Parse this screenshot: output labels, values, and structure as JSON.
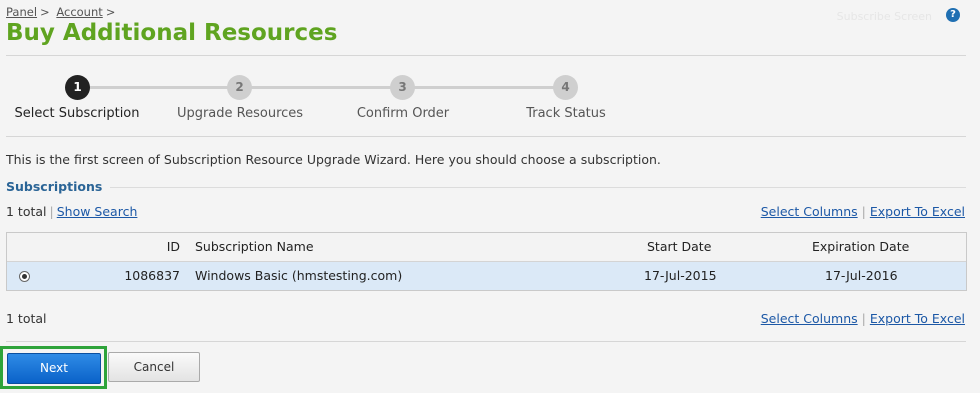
{
  "breadcrumb": {
    "items": [
      "Panel",
      "Account"
    ],
    "separator": ">"
  },
  "top_right_text": "Subscribe Screen",
  "help_icon_label": "?",
  "page_title": "Buy Additional Resources",
  "wizard": {
    "steps": [
      {
        "number": "1",
        "label": "Select Subscription",
        "active": true
      },
      {
        "number": "2",
        "label": "Upgrade Resources",
        "active": false
      },
      {
        "number": "3",
        "label": "Confirm Order",
        "active": false
      },
      {
        "number": "4",
        "label": "Track Status",
        "active": false
      }
    ]
  },
  "intro_text": "This is the first screen of Subscription Resource Upgrade Wizard. Here you should choose a subscription.",
  "section_title": "Subscriptions",
  "list_top": {
    "total": "1 total",
    "show_search": "Show Search",
    "select_columns": "Select Columns",
    "export": "Export To Excel"
  },
  "table": {
    "headers": {
      "id": "ID",
      "name": "Subscription Name",
      "start": "Start Date",
      "expiration": "Expiration Date"
    },
    "rows": [
      {
        "selected": true,
        "id": "1086837",
        "name": "Windows Basic (hmstesting.com)",
        "start": "17-Jul-2015",
        "expiration": "17-Jul-2016"
      }
    ]
  },
  "list_bottom": {
    "total": "1 total",
    "select_columns": "Select Columns",
    "export": "Export To Excel"
  },
  "buttons": {
    "next": "Next",
    "cancel": "Cancel"
  },
  "colors": {
    "title_green": "#5fa420",
    "link_blue": "#1c58a6",
    "section_blue": "#2a6496",
    "selected_row": "#dbe9f7",
    "next_button": "#0a62c9",
    "highlight_border": "#2ea33a"
  }
}
